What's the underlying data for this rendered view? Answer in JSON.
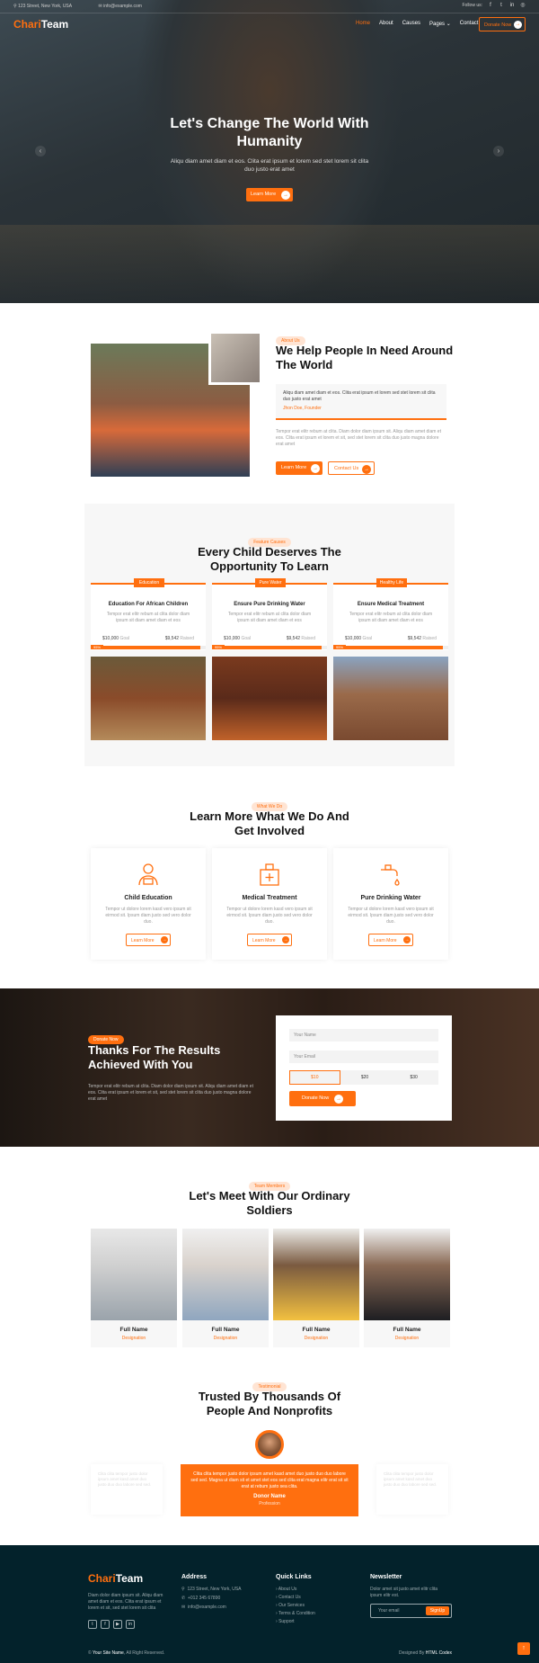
{
  "topbar": {
    "address": "123 Street, New York, USA",
    "email": "info@example.com",
    "follow": "Follow us:"
  },
  "nav": {
    "logo_a": "Chari",
    "logo_b": "Team",
    "menu": [
      "Home",
      "About",
      "Causes",
      "Pages ⌄",
      "Contact"
    ],
    "donate": "Donate Now"
  },
  "hero": {
    "title": "Let's Change The World With Humanity",
    "subtitle": "Aliqu diam amet diam et eos. Clita erat ipsum et lorem sed stet lorem sit clita duo justo erat amet",
    "button": "Learn More"
  },
  "about": {
    "tag": "About Us",
    "title": "We Help People In Need Around The World",
    "quote": "Aliqu diam amet diam et eos. Clita erat ipsum et lorem sed stet lorem sit clita duo justo erat amet",
    "quote_author": "Jhon Doe, Founder",
    "text": "Tempor erat elitr rebum at clita. Diam dolor diam ipsum sit. Aliqu diam amet diam et eos. Clita erat ipsum et lorem et sit, sed stet lorem sit clita duo justo magna dolore erat amet",
    "btn1": "Learn More",
    "btn2": "Contact Us"
  },
  "causes": {
    "tag": "Feature Causes",
    "title": "Every Child Deserves The Opportunity To Learn",
    "items": [
      {
        "label": "Education",
        "title": "Education For African Children",
        "desc": "Tempor erat elitr rebum at clita dolor diam ipsum sit diam amet diam et eos",
        "goal": "$10,000",
        "goal_l": "Goal",
        "raised": "$9,542",
        "raised_l": "Raised",
        "pct": "95%",
        "progress": 0.95
      },
      {
        "label": "Pure Water",
        "title": "Ensure Pure Drinking Water",
        "desc": "Tempor erat elitr rebum at clita dolor diam ipsum sit diam amet diam et eos",
        "goal": "$10,000",
        "goal_l": "Goal",
        "raised": "$9,542",
        "raised_l": "Raised",
        "pct": "95%",
        "progress": 0.95
      },
      {
        "label": "Healthy Life",
        "title": "Ensure Medical Treatment",
        "desc": "Tempor erat elitr rebum at clita dolor diam ipsum sit diam amet diam et eos",
        "goal": "$10,000",
        "goal_l": "Goal",
        "raised": "$9,542",
        "raised_l": "Raised",
        "pct": "95%",
        "progress": 0.95
      }
    ]
  },
  "services": {
    "tag": "What We Do",
    "title": "Learn More What We Do And Get Involved",
    "items": [
      {
        "title": "Child Education",
        "desc": "Tempor ut dolore lorem kasd vero ipsum sit eirmod sit. Ipsum diam justo sed vero dolor duo.",
        "button": "Learn More"
      },
      {
        "title": "Medical Treatment",
        "desc": "Tempor ut dolore lorem kasd vero ipsum sit eirmod sit. Ipsum diam justo sed vero dolor duo.",
        "button": "Learn More"
      },
      {
        "title": "Pure Drinking Water",
        "desc": "Tempor ut dolore lorem kasd vero ipsum sit eirmod sit. Ipsum diam justo sed vero dolor duo.",
        "button": "Learn More"
      }
    ]
  },
  "donate": {
    "tag": "Donate Now",
    "title": "Thanks For The Results Achieved With You",
    "text": "Tempor erat elitr rebum at clita. Diam dolor diam ipsum sit. Aliqu diam amet diam et eos. Clita erat ipsum et lorem et sit, sed stet lorem sit clita duo justo magna dolore erat amet",
    "name_ph": "Your Name",
    "email_ph": "Your Email",
    "amounts": [
      "$10",
      "$20",
      "$30"
    ],
    "button": "Donate Now"
  },
  "team": {
    "tag": "Team Members",
    "title": "Let's Meet With Our Ordinary Soldiers",
    "members": [
      {
        "name": "Full Name",
        "role": "Designation"
      },
      {
        "name": "Full Name",
        "role": "Designation"
      },
      {
        "name": "Full Name",
        "role": "Designation"
      },
      {
        "name": "Full Name",
        "role": "Designation"
      }
    ]
  },
  "testimonial": {
    "tag": "Testimonial",
    "title": "Trusted By Thousands Of People And Nonprofits",
    "quote": "Clita clita tempor justo dolor ipsum amet kasd amet duo justo duo duo labore sed sed. Magna ut diam sit et amet stet eos sed clita erat magna elitr erat sit sit erat at rebum justo sea clita.",
    "side_quote": "Clita clita tempor justo dolor ipsum amet kasd amet duo justo duo duo labore sed sed.",
    "name": "Donor Name",
    "profession": "Profession"
  },
  "footer": {
    "logo_a": "Chari",
    "logo_b": "Team",
    "about": "Diam dolor diam ipsum sit. Aliqu diam amet diam et eos. Clita erat ipsum et lorem et sit, sed stet lorem sit clita",
    "address_h": "Address",
    "address": "123 Street, New York, USA",
    "phone": "+012 345 67890",
    "email": "info@example.com",
    "links_h": "Quick Links",
    "links": [
      "About Us",
      "Contact Us",
      "Our Services",
      "Terms & Condition",
      "Support"
    ],
    "news_h": "Newsletter",
    "news_text": "Dolor amet sit justo amet elitr clita ipsum elitr est.",
    "news_ph": "Your email",
    "news_btn": "SignUp",
    "copy_a": "©",
    "copy_site": "Your Site Name",
    "copy_b": ", All Right Reserved.",
    "designed": "Designed By",
    "designer": "HTML Codex"
  },
  "colors": {
    "accent": "#ff6f0f",
    "dark": "#03222b"
  }
}
